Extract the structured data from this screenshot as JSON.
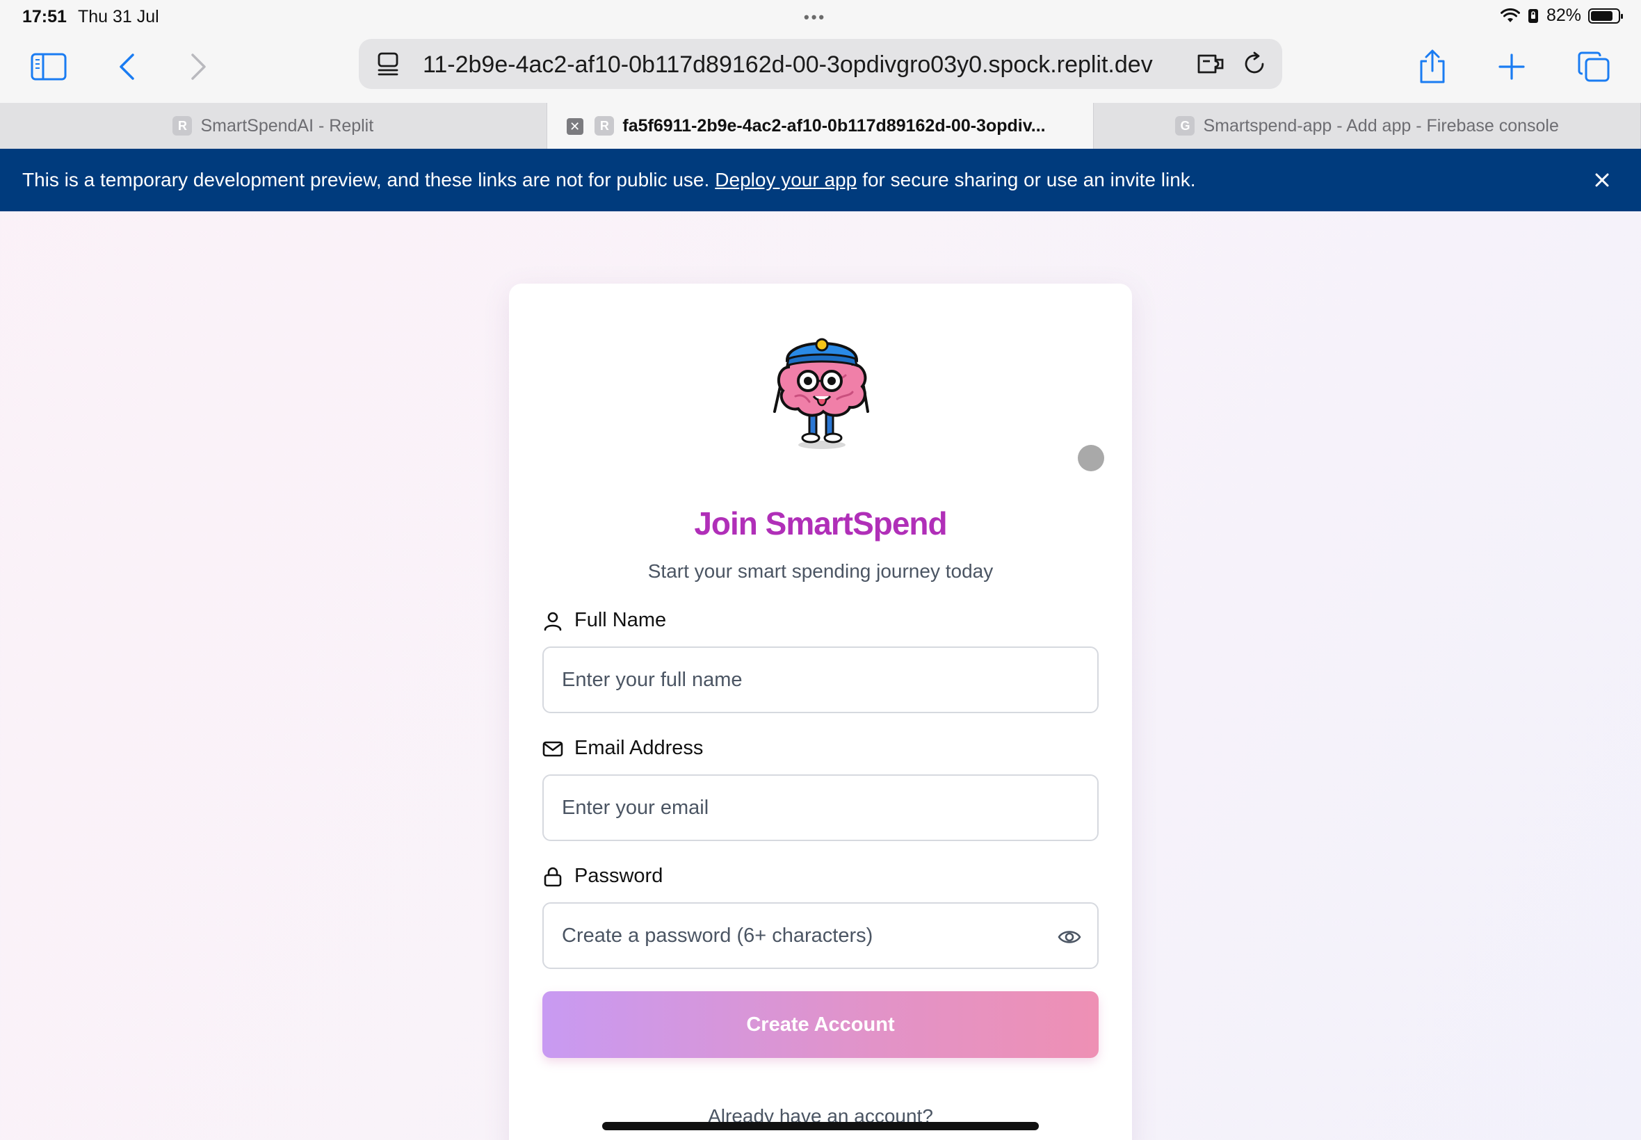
{
  "status_bar": {
    "time": "17:51",
    "date": "Thu 31 Jul",
    "battery_percent": "82%",
    "battery_level": 0.82
  },
  "browser": {
    "url": "11-2b9e-4ac2-af10-0b117d89162d-00-3opdivgro03y0.spock.replit.dev",
    "tabs": [
      {
        "favicon": "R",
        "label": "SmartSpendAI - Replit",
        "active": false
      },
      {
        "favicon": "R",
        "label": "fa5f6911-2b9e-4ac2-af10-0b117d89162d-00-3opdiv...",
        "active": true
      },
      {
        "favicon": "G",
        "label": "Smartspend-app - Add app - Firebase console",
        "active": false
      }
    ],
    "accent_color": "#1a7cf2"
  },
  "banner": {
    "text_before": "This is a temporary development preview, and these links are not for public use.",
    "link_text": "Deploy your app",
    "text_after": "for secure sharing or use an invite link.",
    "background_color": "#003b7d"
  },
  "signup": {
    "title": "Join SmartSpend",
    "subtitle": "Start your smart spending journey today",
    "title_color": "#b02fb8",
    "fields": {
      "name": {
        "label": "Full Name",
        "placeholder": "Enter your full name",
        "icon": "user-icon"
      },
      "email": {
        "label": "Email Address",
        "placeholder": "Enter your email",
        "icon": "mail-icon"
      },
      "password": {
        "label": "Password",
        "placeholder": "Create a password (6+ characters)",
        "icon": "lock-icon"
      }
    },
    "submit_label": "Create Account",
    "signin_prompt": "Already have an account?"
  }
}
